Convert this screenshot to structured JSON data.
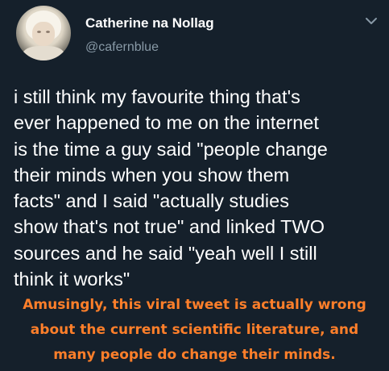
{
  "author": {
    "display_name": "Catherine na Nollag",
    "handle": "@cafernblue"
  },
  "icons": {
    "avatar": "profile-photo",
    "menu": "chevron-down-icon"
  },
  "tweet": {
    "lines": [
      "i still think my favourite thing that's",
      "ever happened to me on the internet",
      "is the time a guy said \"people change",
      "their minds when you show them",
      "facts\" and I said \"actually studies",
      "show that's not true\" and linked TWO",
      "sources and he said \"yeah well I still",
      "think it works\""
    ]
  },
  "overlay_caption": {
    "lines": [
      "Amusingly, this viral tweet is actually wrong",
      "about the current scientific literature, and",
      "many people do change their minds."
    ]
  },
  "colors": {
    "background": "#15202b",
    "name": "#ffffff",
    "handle": "#8899a6",
    "tweet_text": "#ffffff",
    "caption": "#ff7f2a"
  }
}
